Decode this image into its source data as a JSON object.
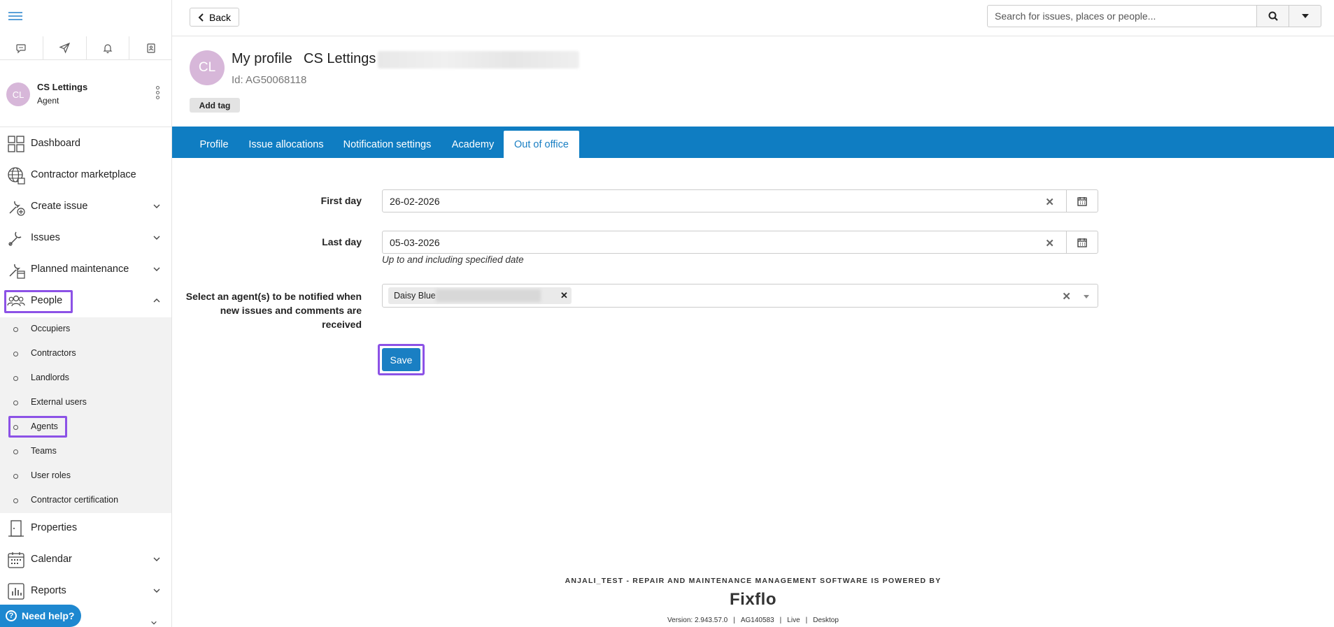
{
  "sidebar": {
    "user": {
      "initials": "CL",
      "name": "CS Lettings",
      "role": "Agent"
    },
    "nav": {
      "dashboard": "Dashboard",
      "marketplace": "Contractor marketplace",
      "create_issue": "Create issue",
      "issues": "Issues",
      "planned_maintenance": "Planned maintenance",
      "people": "People",
      "properties": "Properties",
      "calendar": "Calendar",
      "reports": "Reports"
    },
    "people_sub": [
      "Occupiers",
      "Contractors",
      "Landlords",
      "External users",
      "Agents",
      "Teams",
      "User roles",
      "Contractor certification"
    ],
    "need_help": "Need help?"
  },
  "header": {
    "back_label": "Back",
    "search_placeholder": "Search for issues, places or people..."
  },
  "profile": {
    "initials": "CL",
    "title": "My profile",
    "name": "CS Lettings",
    "id": "Id: AG50068118",
    "add_tag": "Add tag"
  },
  "tabs": [
    "Profile",
    "Issue allocations",
    "Notification settings",
    "Academy",
    "Out of office"
  ],
  "form": {
    "first_day_label": "First day",
    "first_day_value": "26-02-2026",
    "last_day_label": "Last day",
    "last_day_value": "05-03-2026",
    "last_day_hint": "Up to and including specified date",
    "agents_label_1": "Select an agent(s) to be notified when",
    "agents_label_2": "new issues and comments are",
    "agents_label_3": "received",
    "agent_chip": "Daisy Blue",
    "save_label": "Save"
  },
  "footer": {
    "powered_by": "ANJALI_TEST - REPAIR AND MAINTENANCE MANAGEMENT SOFTWARE IS POWERED BY",
    "logo": "Fixflo",
    "version": "Version: 2.943.57.0",
    "code": "AG140583",
    "env": "Live",
    "mode": "Desktop"
  },
  "colors": {
    "accent": "#0f7dc2",
    "highlight": "#8c52e6",
    "avatar": "#d7b7d9"
  }
}
